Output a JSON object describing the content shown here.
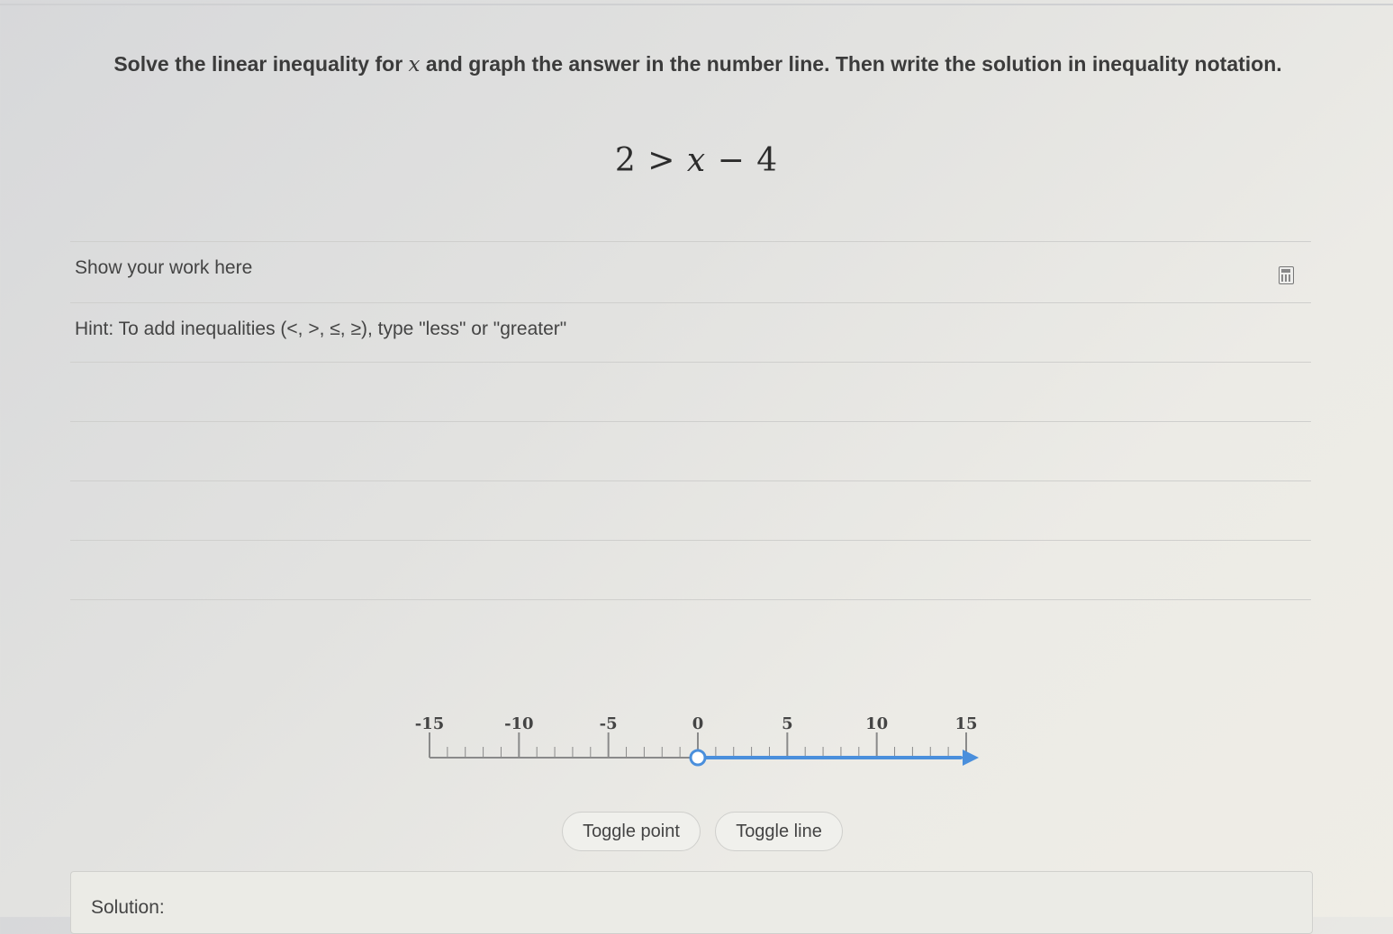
{
  "question": {
    "prompt_before_var": "Solve the linear inequality for ",
    "variable": "x",
    "prompt_after_var": " and graph the answer in the number line. Then write the solution in inequality notation.",
    "equation": {
      "left": "2",
      "operator": ">",
      "variable": "x",
      "minus": "−",
      "constant": "4"
    }
  },
  "work_area": {
    "label": "Show your work here",
    "hint": "Hint: To add inequalities (<, >, ≤, ≥), type \"less\" or \"greater\"",
    "calculator_icon": "calculator-icon"
  },
  "number_line": {
    "min": -15,
    "max": 15,
    "minor_step": 1,
    "major_step": 5,
    "labels": [
      "-15",
      "-10",
      "-5",
      "0",
      "5",
      "10",
      "15"
    ],
    "point": {
      "value": 0,
      "closed": false
    },
    "ray": {
      "from": 0,
      "direction": "right"
    },
    "axis_color": "#8a8a8a",
    "solution_color": "#4a8fdc"
  },
  "buttons": {
    "toggle_point": "Toggle point",
    "toggle_line": "Toggle line"
  },
  "solution": {
    "label": "Solution:"
  }
}
